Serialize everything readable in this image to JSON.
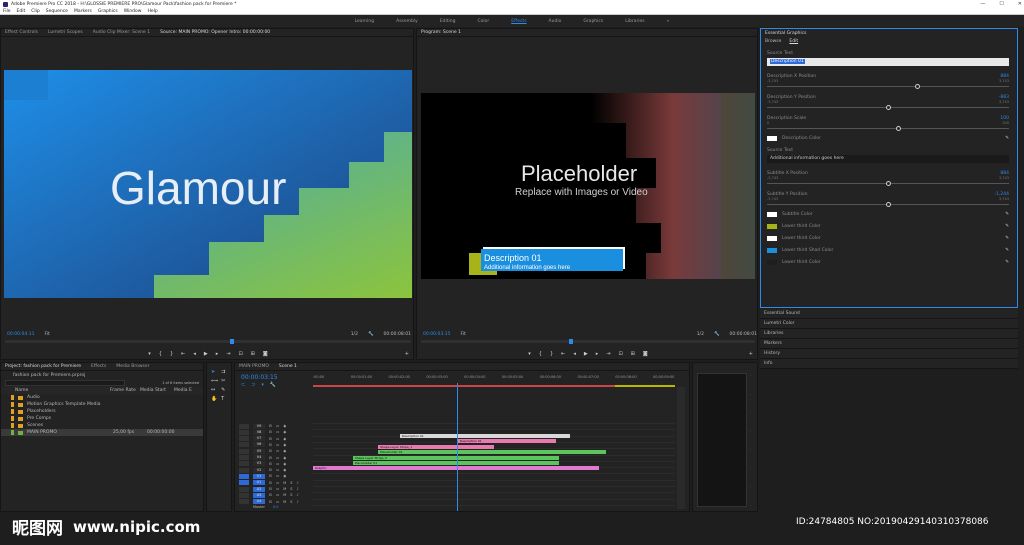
{
  "window": {
    "title": "Adobe Premiere Pro CC 2018 - H:\\GLOSSIE PREMIERE PRO\\Glamour Pack\\fashion pack for Premiere *",
    "minimize": "—",
    "maximize": "☐",
    "close": "✕"
  },
  "menu": [
    "File",
    "Edit",
    "Clip",
    "Sequence",
    "Markers",
    "Graphics",
    "Window",
    "Help"
  ],
  "workspaces": [
    "Learning",
    "Assembly",
    "Editing",
    "Color",
    "Effects",
    "Audio",
    "Graphics",
    "Libraries"
  ],
  "active_workspace": "Effects",
  "workspace_more": "»",
  "source_panel": {
    "tabs": [
      "Effect Controls",
      "Lumetri Scopes",
      "Audio Clip Mixer: Scene 1",
      "Source: MAIN PROMO: Opener Intro: 00:00:00:00"
    ],
    "active_tab": "Source: MAIN PROMO: Opener Intro: 00:00:00:00",
    "preview_text": "Glamour",
    "timecode": "00:00:04:11",
    "fit": "Fit",
    "ratio": "1/2",
    "duration": "00:00:08:01"
  },
  "program_panel": {
    "tab": "Program: Scene 1",
    "title_text": "Placeholder",
    "subtitle_text": "Replace with Images or Video",
    "description_title": "Description 01",
    "description_body": "Additional information goes here",
    "timecode": "00:00:03:15",
    "fit": "Fit",
    "ratio": "1/2",
    "duration": "00:00:08:01"
  },
  "essential_graphics": {
    "title": "Essential Graphics",
    "tabs": [
      "Browse",
      "Edit"
    ],
    "active_tab": "Edit",
    "source_text_label": "Source Text",
    "source_text_value": "Description 01",
    "rows": [
      {
        "label": "Description X Position",
        "min": "-3,743",
        "max": "3,743",
        "value": "884",
        "knob": 0.62
      },
      {
        "label": "Description Y Position",
        "min": "-3,743",
        "max": "3,743",
        "value": "-883",
        "knob": 0.5
      },
      {
        "label": "Description Scale",
        "min": "0",
        "max": "200",
        "value": "100",
        "knob": 0.54
      }
    ],
    "color_rows_1": [
      {
        "label": "Description Color",
        "color": "#ffffff"
      }
    ],
    "source_text_2_label": "Source Text",
    "source_text_2_value": "Additional information goes here",
    "rows_2": [
      {
        "label": "Subtitle X Position",
        "min": "-3,743",
        "max": "3,743",
        "value": "884",
        "knob": 0.5
      },
      {
        "label": "Subtitle Y Position",
        "min": "-3,743",
        "max": "3,743",
        "value": "-1,244",
        "knob": 0.5
      }
    ],
    "color_rows_2": [
      {
        "label": "Subtitle Color",
        "color": "#ffffff"
      },
      {
        "label": "Lower third Color",
        "color": "#a6b319"
      },
      {
        "label": "Lower third Color",
        "color": "#ffffff"
      },
      {
        "label": "Lower third Shad Color",
        "color": "#1a8fe0"
      },
      {
        "label": "Lower third Color",
        "color": "#1e1e1e"
      }
    ],
    "collapsed_panels": [
      "Essential Sound",
      "Lumetri Color",
      "Libraries",
      "Markers",
      "History",
      "Info"
    ]
  },
  "project_panel": {
    "tabs": [
      "Project: fashion pack for Premiere",
      "Effects",
      "Media Browser"
    ],
    "active_tab": "Project: fashion pack for Premiere",
    "path": "fashion pack for Premiere.prproj",
    "items_count": "1 of 6 items selected",
    "columns": [
      "Name",
      "Frame Rate",
      "Media Start",
      "Media E"
    ],
    "items": [
      {
        "name": "Audio",
        "color": "#e0a020",
        "type": "folder",
        "frame_rate": "",
        "media_start": ""
      },
      {
        "name": "Motion Graphics Template Media",
        "color": "#e0a020",
        "type": "folder",
        "frame_rate": "",
        "media_start": ""
      },
      {
        "name": "Placeholders",
        "color": "#e0a020",
        "type": "folder",
        "frame_rate": "",
        "media_start": ""
      },
      {
        "name": "Pre Comps",
        "color": "#e0a020",
        "type": "folder",
        "frame_rate": "",
        "media_start": ""
      },
      {
        "name": "Scenes",
        "color": "#e0a020",
        "type": "folder",
        "frame_rate": "",
        "media_start": ""
      },
      {
        "name": "MAIN PROMO",
        "color": "#6db33f",
        "type": "sequence",
        "frame_rate": "25,00 fps",
        "media_start": "00:00:00:00"
      }
    ]
  },
  "timeline": {
    "tabs": [
      "MAIN PROMO",
      "Scene 1"
    ],
    "active_tab": "Scene 1",
    "timecode": "00:00:03:15",
    "ruler": [
      ":00:00",
      "00:00:01:00",
      "00:00:02:00",
      "00:00:03:00",
      "00:00:04:00",
      "00:00:05:00",
      "00:00:06:00",
      "00:00:07:00",
      "00:00:08:00",
      "00:00:09:00"
    ],
    "video_tracks": [
      "V9",
      "V8",
      "V7",
      "V6",
      "V5",
      "V4",
      "V3",
      "V2",
      "V1"
    ],
    "audio_tracks": [
      "A1",
      "A2",
      "A3",
      "A4"
    ],
    "master_label": "Master",
    "master_value": "0.0",
    "clips": [
      {
        "name": "Description 01",
        "color": "#d8d8d8",
        "start": 0.24,
        "end": 0.71,
        "row": 0
      },
      {
        "name": "Description 01",
        "color": "#e87ab0",
        "start": 0.4,
        "end": 0.67,
        "row": 1
      },
      {
        "name": "Shape Layer Stripe_1",
        "color": "#e87ab0",
        "start": 0.18,
        "end": 0.5,
        "row": 2
      },
      {
        "name": "Placeholder 01",
        "color": "#5cc45c",
        "start": 0.18,
        "end": 0.81,
        "row": 3
      },
      {
        "name": "Shape Layer Stripe_3",
        "color": "#5cc45c",
        "start": 0.11,
        "end": 0.68,
        "row": 4
      },
      {
        "name": "Placeholder 01",
        "color": "#5cc45c",
        "start": 0.11,
        "end": 0.68,
        "row": 5
      },
      {
        "name": "Graphic",
        "color": "#e07ad0",
        "start": 0.0,
        "end": 0.79,
        "row": 6
      }
    ]
  },
  "watermark": {
    "site_cn": "昵图网",
    "site_url": "www.nipic.com",
    "id": "ID:24784805 NO:20190429140310378086"
  }
}
